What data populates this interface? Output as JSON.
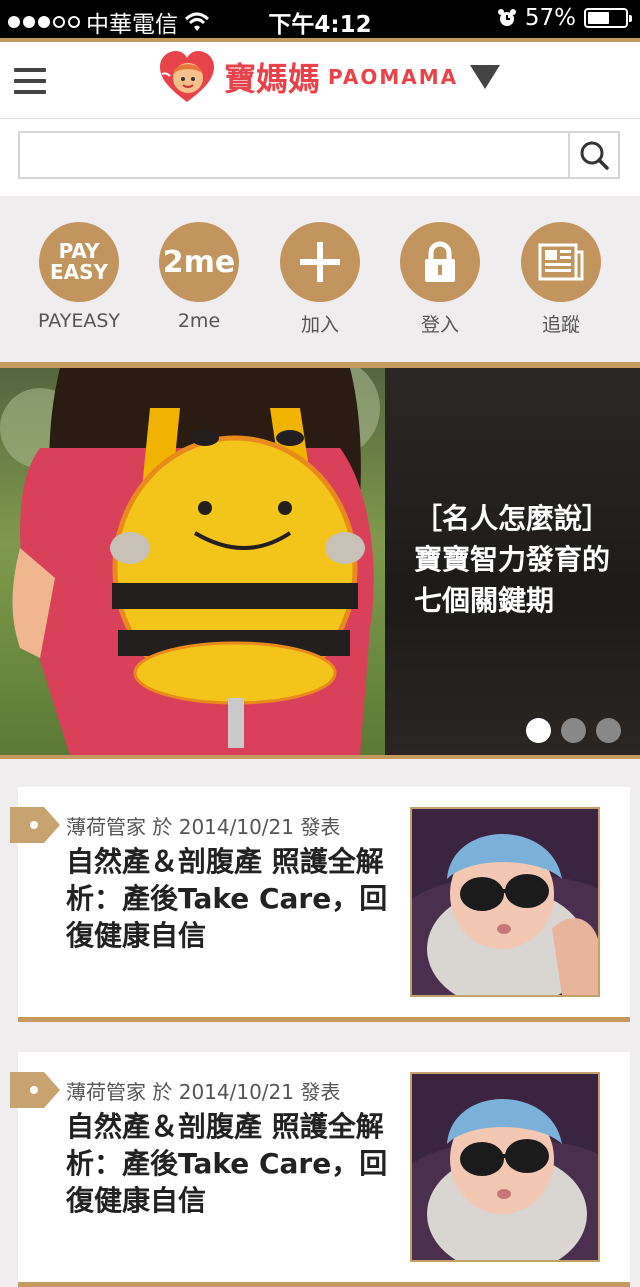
{
  "status": {
    "carrier": "中華電信",
    "time": "下午4:12",
    "battery": "57%",
    "battery_level": 0.57,
    "signal_bars": 3
  },
  "header": {
    "logo_cn": "寶媽媽",
    "logo_en": "PAOMAMA"
  },
  "search": {
    "value": "",
    "placeholder": ""
  },
  "quicknav": [
    {
      "label": "PAYEASY",
      "icon_line1": "PAY",
      "icon_line2": "EASY"
    },
    {
      "label": "2me",
      "icon_text": "2me"
    },
    {
      "label": "加入",
      "icon": "plus-icon"
    },
    {
      "label": "登入",
      "icon": "lock-icon"
    },
    {
      "label": "追蹤",
      "icon": "newspaper-icon"
    }
  ],
  "banner": {
    "line1": "［名人怎麼說］",
    "line2": "寶寶智力發育的",
    "line3": "七個關鍵期",
    "pages": 3,
    "active_page": 1
  },
  "articles": [
    {
      "meta": "薄荷管家 於 2014/10/21 發表",
      "title": "自然產＆剖腹產 照護全解析：產後Take Care，回復健康自信"
    },
    {
      "meta": "薄荷管家 於 2014/10/21 發表",
      "title": "自然產＆剖腹產 照護全解析：產後Take Care，回復健康自信"
    }
  ],
  "colors": {
    "accent_gold": "#c49a60",
    "icon_gold": "#c1955d",
    "brand_red": "#e8434a"
  }
}
